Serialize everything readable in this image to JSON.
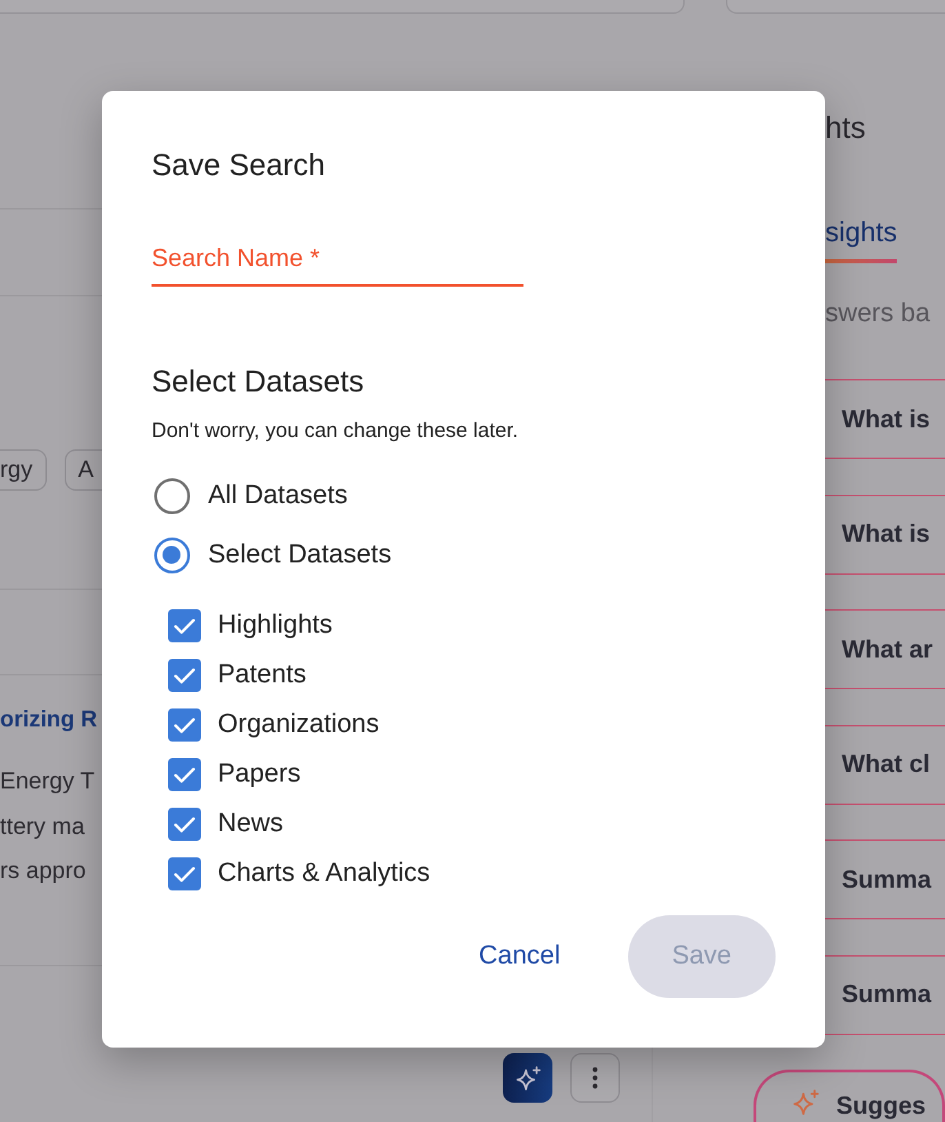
{
  "left_panel": {
    "tags": [
      {
        "label": "rgy"
      },
      {
        "label": "A"
      }
    ],
    "result_title": "orizing R",
    "snippet_lines": [
      "Energy T",
      "ttery ma",
      "rs appro"
    ]
  },
  "right_panel": {
    "heading": "hts",
    "tabs": [
      {
        "label": "sights",
        "selected": true
      }
    ],
    "subtitle": "swers ba",
    "questions": [
      "What is",
      "What is",
      "What ar",
      "What cl",
      "Summa",
      "Summa"
    ],
    "suggest_button": {
      "label": "Sugges"
    }
  },
  "dialog": {
    "title": "Save Search",
    "search_name": {
      "label": "Search Name *",
      "invalid": true
    },
    "section_title": "Select Datasets",
    "hint": "Don't worry, you can change these later.",
    "scope_options": [
      {
        "label": "All Datasets",
        "selected": false
      },
      {
        "label": "Select Datasets",
        "selected": true
      }
    ],
    "datasets": [
      {
        "label": "Highlights",
        "checked": true
      },
      {
        "label": "Patents",
        "checked": true
      },
      {
        "label": "Organizations",
        "checked": true
      },
      {
        "label": "Papers",
        "checked": true
      },
      {
        "label": "News",
        "checked": true
      },
      {
        "label": "Charts & Analytics",
        "checked": true
      }
    ],
    "buttons": [
      {
        "label": "Cancel",
        "kind": "text",
        "disabled": false
      },
      {
        "label": "Save",
        "kind": "filled",
        "disabled": true
      }
    ]
  }
}
